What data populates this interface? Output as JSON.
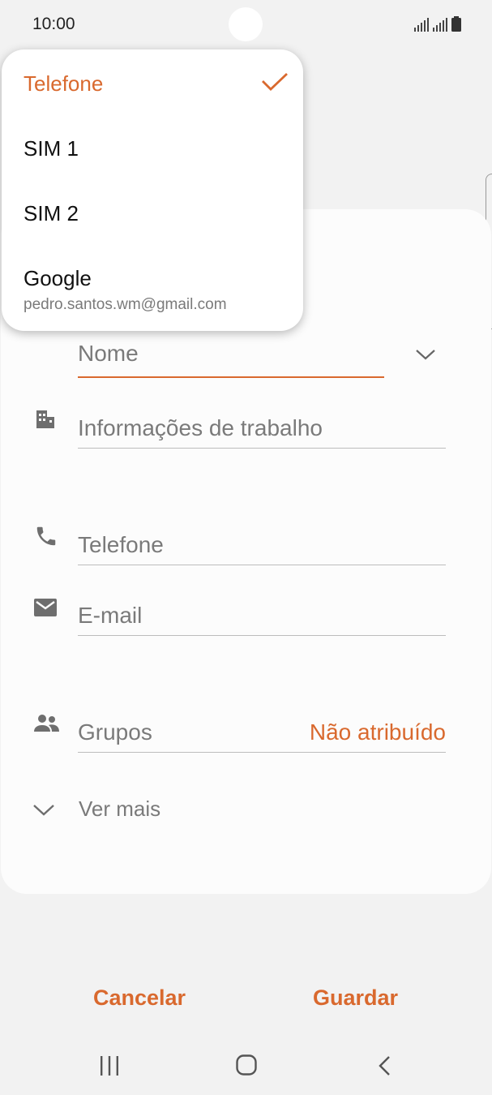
{
  "status_bar": {
    "time": "10:00"
  },
  "dropdown": {
    "items": [
      {
        "label": "Telefone",
        "selected": true
      },
      {
        "label": "SIM 1"
      },
      {
        "label": "SIM 2"
      },
      {
        "label": "Google",
        "sublabel": "pedro.santos.wm@gmail.com"
      }
    ]
  },
  "form": {
    "name_placeholder": "Nome",
    "work_info_placeholder": "Informações de trabalho",
    "phone_placeholder": "Telefone",
    "email_placeholder": "E-mail",
    "groups_label": "Grupos",
    "groups_value": "Não atribuído",
    "see_more_label": "Ver mais"
  },
  "actions": {
    "cancel_label": "Cancelar",
    "save_label": "Guardar"
  },
  "nav": {
    "icons": [
      "recent-apps-icon",
      "home-icon",
      "back-icon"
    ]
  },
  "colors": {
    "accent": "#d9692e",
    "background": "#f2f2f2",
    "card": "#fcfcfc",
    "divider": "#bdbdbd"
  }
}
